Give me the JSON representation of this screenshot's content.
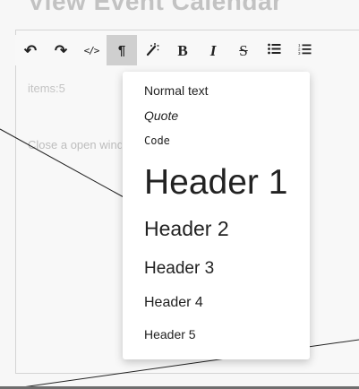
{
  "page": {
    "title": "View Event Calendar",
    "items_label": "items:5",
    "editor_placeholder": "Close a open window"
  },
  "toolbar": {
    "buttons": [
      {
        "name": "undo",
        "glyph": "↶",
        "icon": "undo-icon",
        "active": false
      },
      {
        "name": "redo",
        "glyph": "↷",
        "icon": "redo-icon",
        "active": false
      },
      {
        "name": "code",
        "glyph": "</>",
        "icon": "code-icon",
        "active": false
      },
      {
        "name": "paragraph",
        "glyph": "¶",
        "icon": "paragraph-icon",
        "active": true
      },
      {
        "name": "clear-format",
        "glyph": "⁄",
        "icon": "magic-wand-icon",
        "active": false
      },
      {
        "name": "bold",
        "glyph": "B",
        "icon": "bold-icon",
        "active": false
      },
      {
        "name": "italic",
        "glyph": "I",
        "icon": "italic-icon",
        "active": false
      },
      {
        "name": "strikethrough",
        "glyph": "S",
        "icon": "strikethrough-icon",
        "active": false
      },
      {
        "name": "bullet-list",
        "glyph": "☰",
        "icon": "bullet-list-icon",
        "active": false
      },
      {
        "name": "numbered-list",
        "glyph": "☰",
        "icon": "numbered-list-icon",
        "active": false
      }
    ]
  },
  "dropdown": {
    "items": [
      "Normal text",
      "Quote",
      "Code",
      "Header 1",
      "Header 2",
      "Header 3",
      "Header 4",
      "Header 5"
    ]
  },
  "colors": {
    "accent_active": "#cfcfcf",
    "muted_text": "#c4c4c4",
    "backdrop": "#6e6e6e"
  }
}
